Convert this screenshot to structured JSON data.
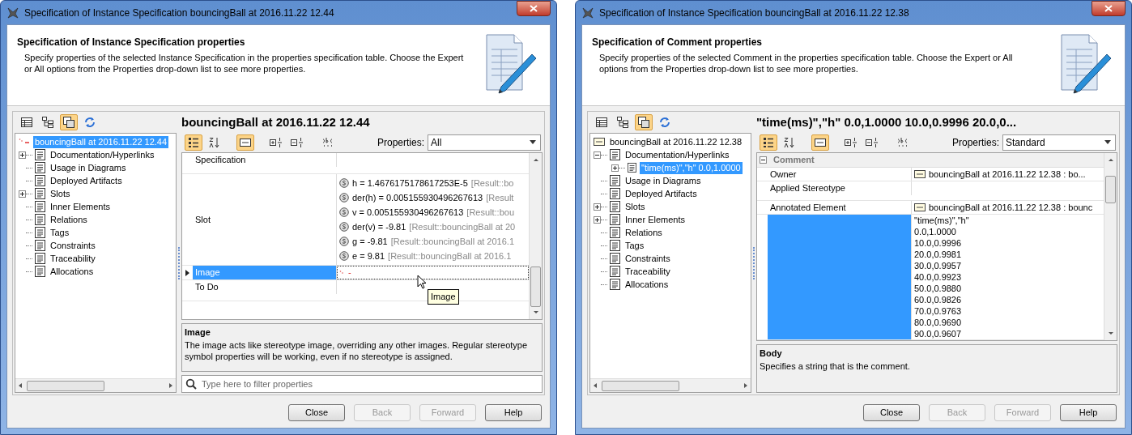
{
  "dialogs": [
    {
      "title": "Specification of Instance Specification bouncingBall at 2016.11.22 12.44",
      "heading": "Specification of Instance Specification properties",
      "description": "Specify properties of the selected Instance Specification in the properties specification table. Choose the Expert or All options from the Properties drop-down list to see more properties.",
      "element_title": "bouncingBall at 2016.11.22 12.44",
      "nav_toolbar": [
        {
          "kind": "table",
          "pressed": false
        },
        {
          "kind": "tree",
          "pressed": false
        },
        {
          "kind": "windows",
          "pressed": true
        },
        {
          "kind": "refresh",
          "pressed": false
        }
      ],
      "tree": [
        {
          "label": "bouncingBall at 2016.11.22 12.44",
          "kind": "unknown",
          "selected": true,
          "children": [
            {
              "label": "Documentation/Hyperlinks",
              "kind": "group",
              "expanded": false,
              "selected": false
            },
            {
              "label": "Usage in Diagrams",
              "kind": "leaf",
              "selected": false
            },
            {
              "label": "Deployed Artifacts",
              "kind": "leaf",
              "selected": false
            },
            {
              "label": "Slots",
              "kind": "group",
              "expanded": false,
              "selected": false
            },
            {
              "label": "Inner Elements",
              "kind": "leaf",
              "selected": false
            },
            {
              "label": "Relations",
              "kind": "leaf",
              "selected": false
            },
            {
              "label": "Tags",
              "kind": "leaf",
              "selected": false
            },
            {
              "label": "Constraints",
              "kind": "leaf",
              "selected": false
            },
            {
              "label": "Traceability",
              "kind": "leaf",
              "selected": false
            },
            {
              "label": "Allocations",
              "kind": "leaf",
              "selected": false
            }
          ]
        }
      ],
      "table_toolbar": [
        {
          "kind": "categorized",
          "pressed": true
        },
        {
          "kind": "sort",
          "pressed": false
        },
        {
          "kind": "field",
          "pressed": true
        },
        {
          "kind": "expand",
          "pressed": false
        },
        {
          "kind": "collapse",
          "pressed": false
        },
        {
          "kind": "spelling",
          "pressed": false
        }
      ],
      "properties_label": "Properties:",
      "properties_value": "All",
      "rows": [
        {
          "kind": "plain",
          "name": "Specification",
          "selected": false
        },
        {
          "kind": "slots",
          "name": "Slot",
          "selected": false,
          "values": [
            {
              "text": "h = 1.4676175178617253E-5",
              "ref": "[Result::bo"
            },
            {
              "text": "der(h) = 0.005155930496267613",
              "ref": "[Result"
            },
            {
              "text": "v = 0.005155930496267613",
              "ref": "[Result::bou"
            },
            {
              "text": "der(v) = -9.81",
              "ref": "[Result::bouncingBall at 20"
            },
            {
              "text": "g = -9.81",
              "ref": "[Result::bouncingBall at 2016.1"
            },
            {
              "text": "e = 9.81",
              "ref": "[Result::bouncingBall at 2016.1"
            }
          ]
        },
        {
          "kind": "image",
          "name": "Image",
          "selected": true,
          "value": "-"
        },
        {
          "kind": "plain",
          "name": "To Do",
          "selected": false
        }
      ],
      "tooltip": "Image",
      "info": {
        "title": "Image",
        "text": "The image acts like stereotype image, overriding any other images. Regular stereotype symbol properties will be working, even if no stereotype is assigned."
      },
      "filter": {
        "placeholder": "Type here to filter properties"
      },
      "buttons": [
        {
          "label": "Close",
          "disabled": false
        },
        {
          "label": "Back",
          "disabled": true
        },
        {
          "label": "Forward",
          "disabled": true
        },
        {
          "label": "Help",
          "disabled": false
        }
      ]
    },
    {
      "title": "Specification of Instance Specification bouncingBall at 2016.11.22 12.38",
      "heading": "Specification of Comment properties",
      "description": "Specify properties of the selected Comment in the properties specification table. Choose the Expert or All options from the Properties drop-down list to see more properties.",
      "element_title": "\"time(ms)\",\"h\" 0.0,1.0000 10.0,0.9996 20.0,0...",
      "nav_toolbar": [
        {
          "kind": "table",
          "pressed": false
        },
        {
          "kind": "tree",
          "pressed": false
        },
        {
          "kind": "windows",
          "pressed": true
        },
        {
          "kind": "refresh",
          "pressed": false
        }
      ],
      "tree": [
        {
          "label": "bouncingBall at 2016.11.22 12.38",
          "kind": "instance",
          "selected": false,
          "children": [
            {
              "label": "Documentation/Hyperlinks",
              "kind": "group",
              "expanded": true,
              "selected": false,
              "children": [
                {
                  "label": "\"time(ms)\",\"h\" 0.0,1.0000",
                  "kind": "comment",
                  "expanded": false,
                  "selected": true
                }
              ]
            },
            {
              "label": "Usage in Diagrams",
              "kind": "leaf",
              "selected": false
            },
            {
              "label": "Deployed Artifacts",
              "kind": "leaf",
              "selected": false
            },
            {
              "label": "Slots",
              "kind": "group",
              "expanded": false,
              "selected": false
            },
            {
              "label": "Inner Elements",
              "kind": "group",
              "expanded": false,
              "selected": false
            },
            {
              "label": "Relations",
              "kind": "leaf",
              "selected": false
            },
            {
              "label": "Tags",
              "kind": "leaf",
              "selected": false
            },
            {
              "label": "Constraints",
              "kind": "leaf",
              "selected": false
            },
            {
              "label": "Traceability",
              "kind": "leaf",
              "selected": false
            },
            {
              "label": "Allocations",
              "kind": "leaf",
              "selected": false
            }
          ]
        }
      ],
      "table_toolbar": [
        {
          "kind": "categorized",
          "pressed": true
        },
        {
          "kind": "sort",
          "pressed": false
        },
        {
          "kind": "field",
          "pressed": true
        },
        {
          "kind": "expand",
          "pressed": false
        },
        {
          "kind": "collapse",
          "pressed": false
        },
        {
          "kind": "spelling",
          "pressed": false
        }
      ],
      "properties_label": "Properties:",
      "properties_value": "Standard",
      "rows": [
        {
          "kind": "group",
          "name": "Comment",
          "expanded": true
        },
        {
          "kind": "element",
          "name": "Owner",
          "selected": false,
          "value": "bouncingBall at 2016.11.22 12.38 : bo..."
        },
        {
          "kind": "plain",
          "name": "Applied Stereotype",
          "selected": false
        },
        {
          "kind": "element",
          "name": "Annotated Element",
          "selected": false,
          "value": "bouncingBall at 2016.11.22 12.38 : bounc"
        },
        {
          "kind": "lines",
          "selected": true,
          "lines": [
            "\"time(ms)\",\"h\"",
            "0.0,1.0000",
            "10.0,0.9996",
            "20.0,0.9981",
            "30.0,0.9957",
            "40.0,0.9923",
            "50.0,0.9880",
            "60.0,0.9826",
            "70.0,0.9763",
            "80.0,0.9690",
            "90.0,0.9607"
          ]
        }
      ],
      "info": {
        "title": "Body",
        "text": "Specifies a string that is the comment."
      },
      "buttons": [
        {
          "label": "Close",
          "disabled": false
        },
        {
          "label": "Back",
          "disabled": true
        },
        {
          "label": "Forward",
          "disabled": true
        },
        {
          "label": "Help",
          "disabled": false
        }
      ]
    }
  ]
}
